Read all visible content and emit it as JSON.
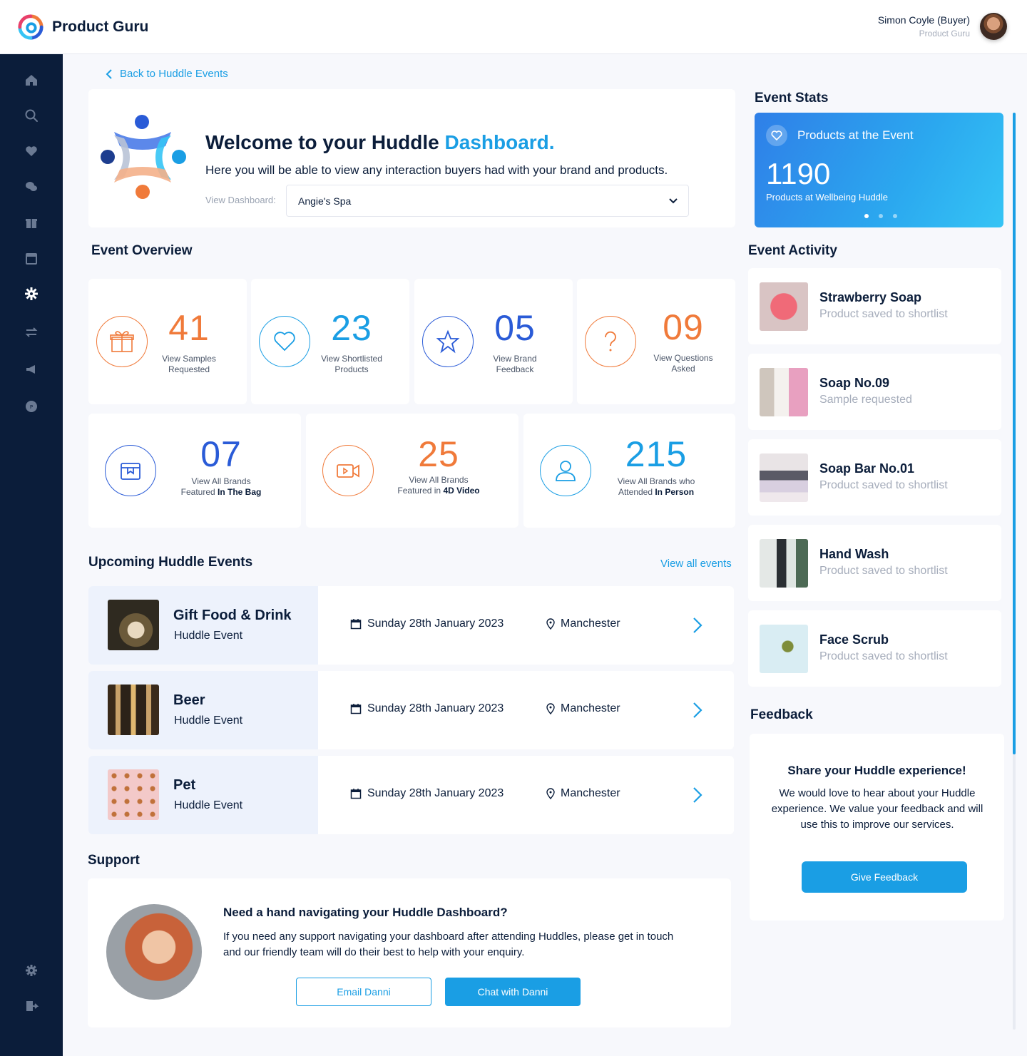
{
  "header": {
    "brand": "Product Guru",
    "user_name": "Simon Coyle (Buyer)",
    "user_org": "Product Guru"
  },
  "sidebar": {
    "icons": [
      "home-icon",
      "search-icon",
      "heart-icon",
      "chat-icon",
      "gift-icon",
      "calendar-icon",
      "cog-icon",
      "swap-icon",
      "megaphone-icon",
      "badge-icon",
      "settings-icon",
      "logout-icon"
    ]
  },
  "back_link": "Back to Huddle Events",
  "welcome": {
    "title_main": "Welcome to your Huddle ",
    "title_accent": "Dashboard.",
    "subtitle": "Here you will be able to view any interaction buyers had with your brand and products.",
    "view_label": "View Dashboard:",
    "selected": "Angie's Spa"
  },
  "overview": {
    "title": "Event Overview",
    "row1": [
      {
        "num": "41",
        "label": "View Samples Requested",
        "icon": "gift-icon"
      },
      {
        "num": "23",
        "label": "View Shortlisted Products",
        "icon": "heart-icon"
      },
      {
        "num": "05",
        "label": "View Brand Feedback",
        "icon": "star-icon"
      },
      {
        "num": "09",
        "label": "View Questions Asked",
        "icon": "question-icon"
      }
    ],
    "row2": [
      {
        "num": "07",
        "label_a": "View All Brands",
        "label_b": "Featured ",
        "label_bold": "In The Bag",
        "icon": "box-icon"
      },
      {
        "num": "25",
        "label_a": "View All Brands",
        "label_b": "Featured in ",
        "label_bold": "4D Video",
        "icon": "video-icon"
      },
      {
        "num": "215",
        "label_a": "View All Brands who",
        "label_b": "Attended ",
        "label_bold": "In Person",
        "icon": "person-icon"
      }
    ]
  },
  "events": {
    "title": "Upcoming Huddle Events",
    "view_all": "View all events",
    "items": [
      {
        "name": "Gift Food & Drink",
        "type": "Huddle Event",
        "date": "Sunday 28th January 2023",
        "location": "Manchester"
      },
      {
        "name": "Beer",
        "type": "Huddle Event",
        "date": "Sunday 28th January 2023",
        "location": "Manchester"
      },
      {
        "name": "Pet",
        "type": "Huddle Event",
        "date": "Sunday 28th January 2023",
        "location": "Manchester"
      }
    ]
  },
  "support": {
    "title": "Support",
    "heading": "Need a hand navigating your Huddle Dashboard?",
    "line1": "If you need any support navigating your dashboard after attending Huddles, please get in touch",
    "line2": "and our friendly team will do their best to help with your enquiry.",
    "email_btn": "Email Danni",
    "chat_btn": "Chat with Danni"
  },
  "event_stats": {
    "title": "Event Stats",
    "label": "Products at the Event",
    "value": "1190",
    "sub": "Products at Wellbeing Huddle",
    "slides": 3,
    "active_slide": 1
  },
  "activity": {
    "title": "Event Activity",
    "items": [
      {
        "name": "Strawberry Soap",
        "desc": "Product saved to shortlist"
      },
      {
        "name": "Soap No.09",
        "desc": "Sample requested"
      },
      {
        "name": "Soap Bar No.01",
        "desc": "Product saved to shortlist"
      },
      {
        "name": "Hand Wash",
        "desc": "Product saved to shortlist"
      },
      {
        "name": "Face Scrub",
        "desc": "Product saved to shortlist"
      }
    ]
  },
  "feedback": {
    "title": "Feedback",
    "heading": "Share your Huddle experience!",
    "text": "We would love to hear about your Huddle experience. We value your feedback and will use this to improve our services.",
    "button": "Give Feedback"
  },
  "colors": {
    "accent": "#1a9ee4",
    "orange": "#f07a3a",
    "navy": "#0b1d3a",
    "royal": "#2a5bd7"
  }
}
